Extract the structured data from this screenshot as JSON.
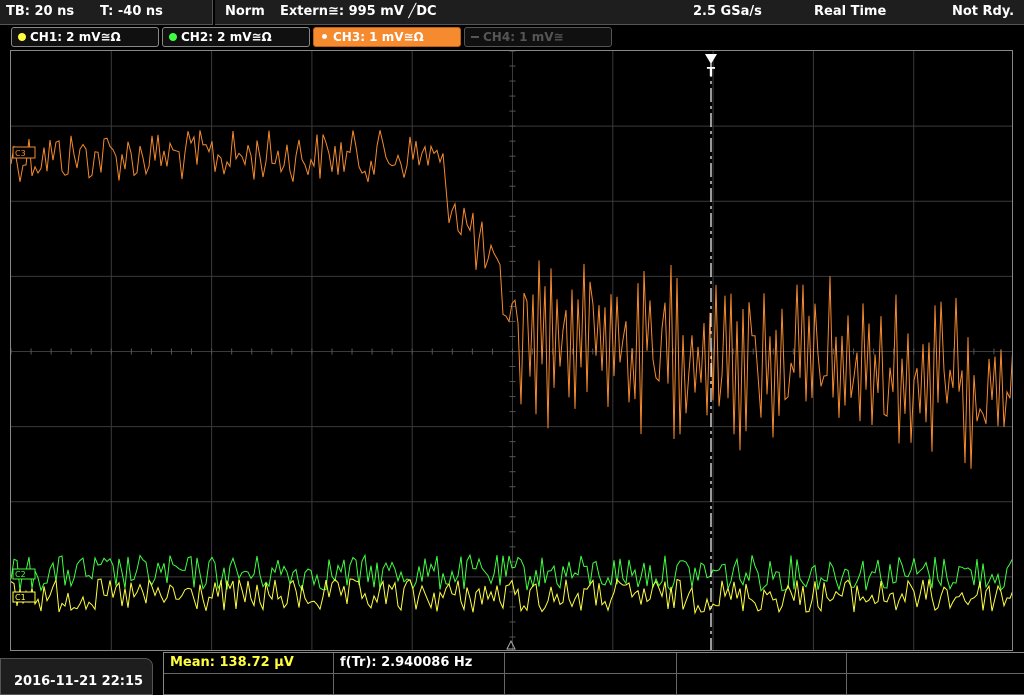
{
  "topbar": {
    "timebase": "TB: 20 ns",
    "trigger_pos": "T: -40 ns",
    "mode": "Norm",
    "trigger_source": "Extern≅: 995 mV ╱DC",
    "sample_rate": "2.5 GSa/s",
    "acq_mode": "Real Time",
    "status": "Not Rdy."
  },
  "channels": [
    {
      "label": "CH1: 2 mV≅Ω",
      "color": "#ffff40",
      "state": "on"
    },
    {
      "label": "CH2: 2 mV≅Ω",
      "color": "#40ff40",
      "state": "on"
    },
    {
      "label": "CH3: 1 mV≅Ω",
      "color": "#f58a2e",
      "state": "active"
    },
    {
      "label": "CH4: 1 mV≅",
      "color": "#555555",
      "state": "off"
    }
  ],
  "markers": {
    "trigger": "T",
    "ch3": "C3",
    "ch2": "C2",
    "ch1": "C1"
  },
  "footer": {
    "datetime": "2016-11-21 22:15",
    "mean": "Mean: 138.72 µV",
    "freq": "f(Tr): 2.940086 Hz"
  },
  "colors": {
    "ch1": "#ffff40",
    "ch2": "#40ff40",
    "ch3": "#f58a2e",
    "grid": "#444444"
  }
}
